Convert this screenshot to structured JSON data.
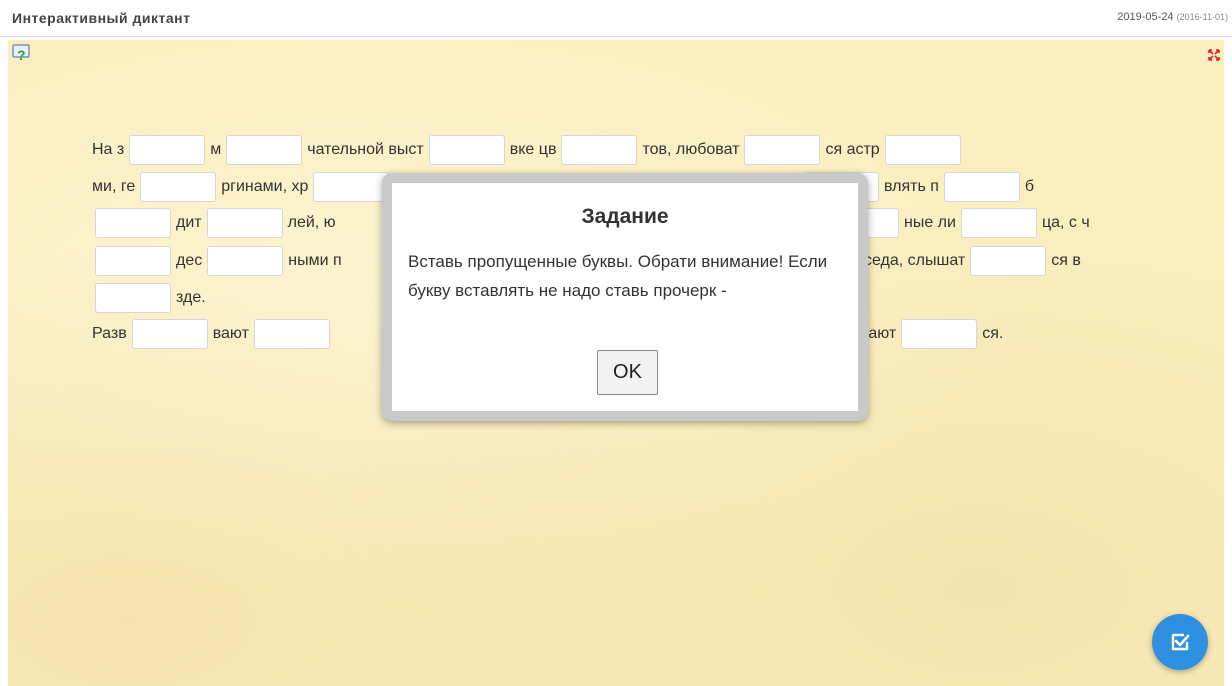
{
  "header": {
    "title": "Интерактивный диктант",
    "date": "2019-05-24",
    "date_created": "(2016-11-01)"
  },
  "dictation": {
    "line1": [
      "На з",
      "м",
      "чательной выст",
      "вке цв",
      "тов, любоват",
      "ся астр"
    ],
    "line2": [
      "ми, ге",
      "ргинами, хр",
      "влять п",
      "б"
    ],
    "line3": [
      "дит",
      "лей, ю",
      "ные ли",
      "ца, с ч"
    ],
    "line4": [
      "дес",
      "ными п",
      "седа, слышат",
      "ся в"
    ],
    "line5": [
      "зде."
    ],
    "line6": [
      "Разв",
      "вают",
      "вают",
      "ся."
    ]
  },
  "modal": {
    "title": "Задание",
    "text": "Вставь пропущенные буквы. Обрати внимание! Если букву вставлять не надо ставь прочерк -",
    "ok_label": "OK"
  },
  "icons": {
    "help": "help-icon",
    "fullscreen": "fullscreen-icon",
    "check": "check-icon"
  },
  "colors": {
    "background": "#fbefc0",
    "accent": "#2f8fe0"
  }
}
